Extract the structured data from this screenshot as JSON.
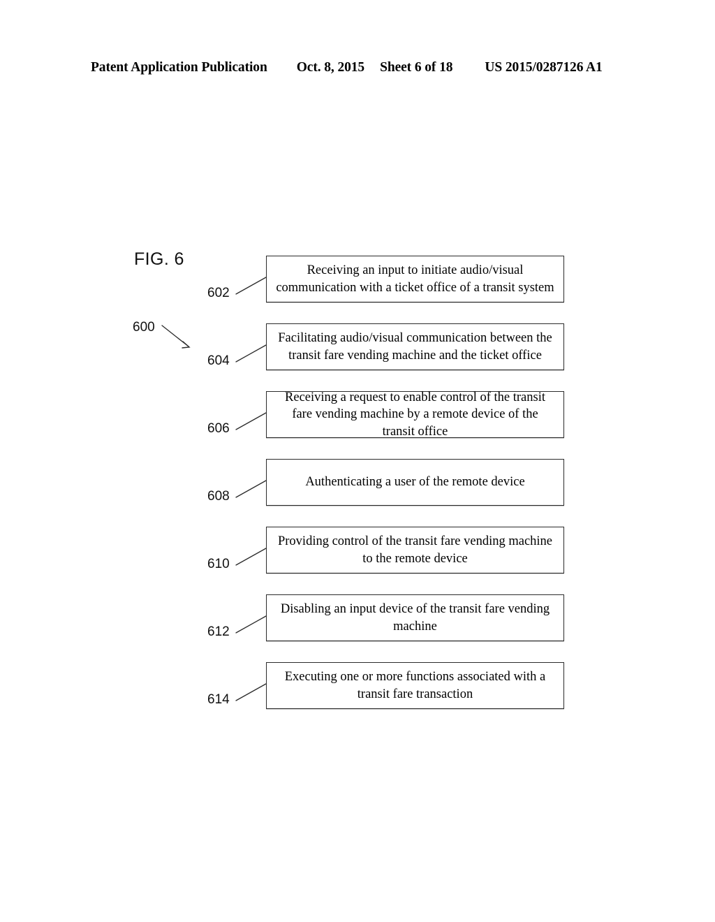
{
  "header": {
    "title": "Patent Application Publication",
    "date": "Oct. 8, 2015",
    "sheet": "Sheet 6 of 18",
    "publication_number": "US 2015/0287126 A1"
  },
  "figure": {
    "label": "FIG. 6",
    "flow_label": "600"
  },
  "flowchart": {
    "steps": [
      {
        "ref": "602",
        "text": "Receiving an input to initiate audio/visual communication with a ticket office of a transit system"
      },
      {
        "ref": "604",
        "text": "Facilitating audio/visual communication between the transit fare vending machine and the ticket office"
      },
      {
        "ref": "606",
        "text": "Receiving a request to enable control of the transit fare vending machine by a remote device of the transit office"
      },
      {
        "ref": "608",
        "text": "Authenticating a user of the remote device"
      },
      {
        "ref": "610",
        "text": "Providing control of the transit fare vending machine to the remote device"
      },
      {
        "ref": "612",
        "text": "Disabling an input device of the transit fare vending machine"
      },
      {
        "ref": "614",
        "text": "Executing one or more functions associated with a transit fare transaction"
      }
    ]
  }
}
